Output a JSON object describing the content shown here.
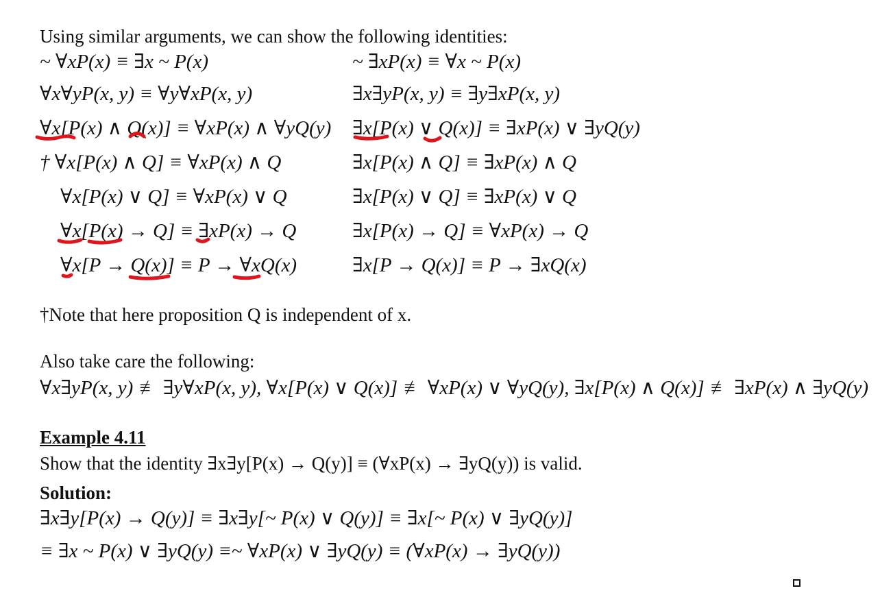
{
  "intro": "Using similar arguments, we can show the following identities:",
  "identities": [
    {
      "left": "~ ∀xP(x) ≡ ∃x ~ P(x)",
      "right": "~ ∃xP(x) ≡ ∀x ~ P(x)"
    },
    {
      "left": "∀x∀yP(x, y) ≡ ∀y∀xP(x, y)",
      "right": "∃x∃yP(x, y) ≡ ∃y∃xP(x, y)"
    },
    {
      "left": "∀x[P(x) ∧ Q(x)] ≡ ∀xP(x) ∧ ∀yQ(y)",
      "right": "∃x[P(x) ∨ Q(x)] ≡ ∃xP(x) ∨ ∃yQ(y)"
    },
    {
      "left": "† ∀x[P(x) ∧ Q] ≡ ∀xP(x) ∧ Q",
      "right": "∃x[P(x) ∧ Q] ≡ ∃xP(x) ∧ Q"
    },
    {
      "left": "∀x[P(x) ∨ Q] ≡ ∀xP(x) ∨ Q",
      "right": "∃x[P(x) ∨ Q] ≡ ∃xP(x) ∨ Q"
    },
    {
      "left": "∀x[P(x) → Q] ≡ ∃xP(x) → Q",
      "right": "∃x[P(x) → Q] ≡ ∀xP(x) → Q"
    },
    {
      "left": "∀x[P → Q(x)] ≡ P → ∀xQ(x)",
      "right": "∃x[P → Q(x)] ≡ P → ∃xQ(x)"
    }
  ],
  "note": "†Note that here proposition Q is independent of x.",
  "also_title": "Also take care the following:",
  "also_equation": "∀x∃yP(x, y) ≢ ∃y∀xP(x, y),  ∀x[P(x) ∨ Q(x)] ≢ ∀xP(x) ∨ ∀yQ(y),  ∃x[P(x) ∧ Q(x)] ≢ ∃xP(x) ∧ ∃yQ(y)",
  "example": {
    "title": "Example 4.11",
    "statement": "Show that the identity  ∃x∃y[P(x) → Q(y)] ≡ (∀xP(x) → ∃yQ(y))  is valid."
  },
  "solution": {
    "title": "Solution:",
    "lines": [
      "∃x∃y[P(x) → Q(y)] ≡ ∃x∃y[~ P(x) ∨ Q(y)] ≡ ∃x[~ P(x) ∨ ∃yQ(y)]",
      "≡ ∃x ~ P(x) ∨ ∃yQ(y) ≡~ ∀xP(x) ∨ ∃yQ(y) ≡ (∀xP(x) → ∃yQ(y))"
    ]
  },
  "colors": {
    "text": "#111111",
    "annotation": "#e0141b"
  }
}
